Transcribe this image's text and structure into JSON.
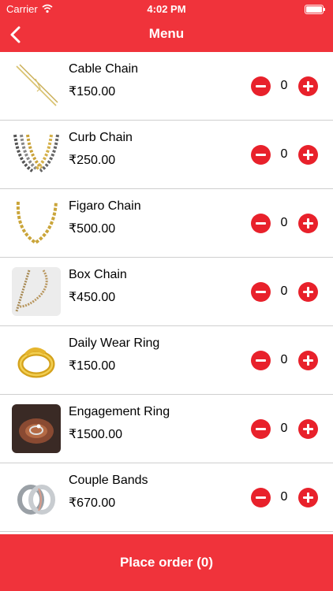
{
  "status_bar": {
    "carrier": "Carrier",
    "time": "4:02 PM"
  },
  "header": {
    "title": "Menu"
  },
  "items": [
    {
      "name": "Cable Chain",
      "price": "₹150.00",
      "qty": "0"
    },
    {
      "name": "Curb Chain",
      "price": "₹250.00",
      "qty": "0"
    },
    {
      "name": "Figaro Chain",
      "price": "₹500.00",
      "qty": "0"
    },
    {
      "name": "Box Chain",
      "price": "₹450.00",
      "qty": "0"
    },
    {
      "name": "Daily Wear Ring",
      "price": "₹150.00",
      "qty": "0"
    },
    {
      "name": "Engagement Ring",
      "price": "₹1500.00",
      "qty": "0"
    },
    {
      "name": "Couple Bands",
      "price": "₹670.00",
      "qty": "0"
    }
  ],
  "footer": {
    "place_order_label": "Place order (0)"
  },
  "colors": {
    "accent": "#f0333b",
    "stepper": "#e8212b"
  }
}
